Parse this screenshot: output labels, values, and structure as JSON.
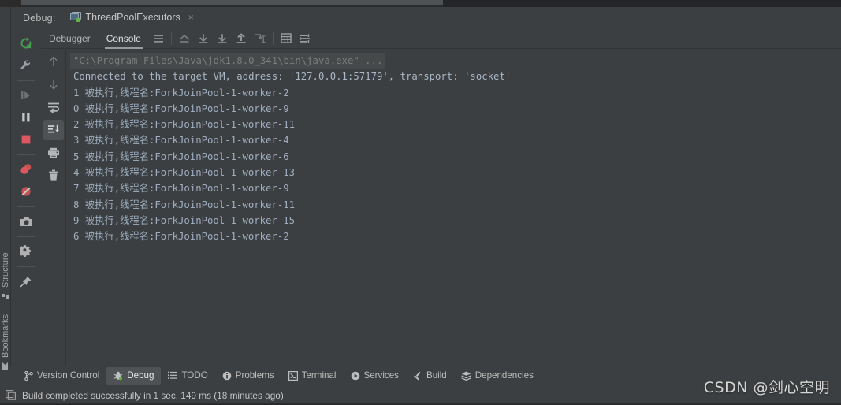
{
  "header": {
    "debug_label": "Debug:",
    "run_config": "ThreadPoolExecutors",
    "close": "×"
  },
  "left_strip": {
    "structure_label": "Structure",
    "bookmarks_label": "Bookmarks"
  },
  "debug_tools": [
    {
      "name": "rerun-icon",
      "title": "Rerun"
    },
    {
      "name": "wrench-icon",
      "title": "Edit Configuration"
    },
    {
      "name": "resume-program-icon",
      "title": "Resume Program"
    },
    {
      "name": "pause-program-icon",
      "title": "Pause Program"
    },
    {
      "name": "stop-icon",
      "title": "Stop"
    },
    {
      "name": "view-breakpoints-icon",
      "title": "View Breakpoints"
    },
    {
      "name": "mute-breakpoints-icon",
      "title": "Mute Breakpoints"
    },
    {
      "name": "camera-icon",
      "title": "Get Thread Dump"
    },
    {
      "name": "settings-gear-icon",
      "title": "Settings"
    },
    {
      "name": "pin-icon",
      "title": "Pin Tab"
    }
  ],
  "console_tools": [
    {
      "name": "up-arrow-icon",
      "title": "Up the Stack Trace",
      "active": false
    },
    {
      "name": "down-arrow-icon",
      "title": "Down the Stack Trace",
      "active": false
    },
    {
      "name": "soft-wrap-icon",
      "title": "Soft-Wrap",
      "active": false
    },
    {
      "name": "scroll-to-end-icon",
      "title": "Scroll to the End",
      "active": true
    },
    {
      "name": "print-icon",
      "title": "Print",
      "active": false
    },
    {
      "name": "trash-icon",
      "title": "Clear All",
      "active": false
    }
  ],
  "debug_tabs": [
    {
      "label": "Debugger",
      "active": false
    },
    {
      "label": "Console",
      "active": true
    }
  ],
  "debug_toolbar_icons": [
    {
      "name": "menu-lines-icon"
    },
    {
      "name": "step-out-icon"
    },
    {
      "name": "step-over-icon"
    },
    {
      "name": "step-into-icon"
    },
    {
      "name": "force-step-into-icon"
    },
    {
      "name": "run-to-cursor-icon"
    },
    {
      "name": "evaluate-table-icon"
    },
    {
      "name": "settings-lines-icon"
    }
  ],
  "console": {
    "lines": [
      {
        "type": "cmd",
        "text": "\"C:\\Program Files\\Java\\jdk1.8.0_341\\bin\\java.exe\" ..."
      },
      {
        "type": "sys",
        "text": "Connected to the target VM, address: '127.0.0.1:57179', transport: 'socket'"
      },
      {
        "type": "log",
        "text": "1 被执行,线程名:ForkJoinPool-1-worker-2"
      },
      {
        "type": "log",
        "text": "0 被执行,线程名:ForkJoinPool-1-worker-9"
      },
      {
        "type": "log",
        "text": "2 被执行,线程名:ForkJoinPool-1-worker-11"
      },
      {
        "type": "log",
        "text": "3 被执行,线程名:ForkJoinPool-1-worker-4"
      },
      {
        "type": "log",
        "text": "5 被执行,线程名:ForkJoinPool-1-worker-6"
      },
      {
        "type": "log",
        "text": "4 被执行,线程名:ForkJoinPool-1-worker-13"
      },
      {
        "type": "log",
        "text": "7 被执行,线程名:ForkJoinPool-1-worker-9"
      },
      {
        "type": "log",
        "text": "8 被执行,线程名:ForkJoinPool-1-worker-11"
      },
      {
        "type": "log",
        "text": "9 被执行,线程名:ForkJoinPool-1-worker-15"
      },
      {
        "type": "log",
        "text": "6 被执行,线程名:ForkJoinPool-1-worker-2"
      }
    ]
  },
  "bottom_tabs": [
    {
      "label": "Version Control",
      "icon": "branch-icon",
      "active": false
    },
    {
      "label": "Debug",
      "icon": "bug-icon",
      "active": true
    },
    {
      "label": "TODO",
      "icon": "todo-list-icon",
      "active": false
    },
    {
      "label": "Problems",
      "icon": "problems-icon",
      "active": false
    },
    {
      "label": "Terminal",
      "icon": "terminal-icon",
      "active": false
    },
    {
      "label": "Services",
      "icon": "services-play-icon",
      "active": false
    },
    {
      "label": "Build",
      "icon": "hammer-icon",
      "active": false
    },
    {
      "label": "Dependencies",
      "icon": "dependencies-layers-icon",
      "active": false
    }
  ],
  "status": {
    "icon": "build-window-icon",
    "text": "Build completed successfully in 1 sec, 149 ms (18 minutes ago)"
  },
  "watermark": "CSDN @剑心空明",
  "colors": {
    "background": "#3c3f41",
    "panel_dark": "#2b2b2b",
    "console_text": "#a9b7c6",
    "accent_green": "#62b543",
    "accent_red": "#db5860",
    "active_tab": "#4e5254"
  }
}
